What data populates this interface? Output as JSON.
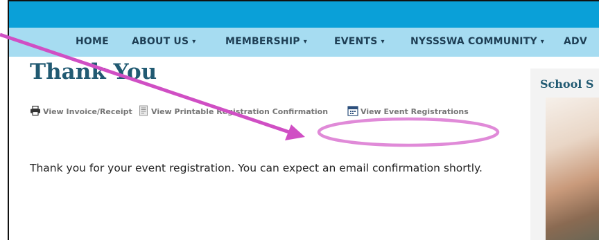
{
  "nav": {
    "items": [
      {
        "label": "HOME",
        "has_caret": false
      },
      {
        "label": "ABOUT US",
        "has_caret": true
      },
      {
        "label": "MEMBERSHIP",
        "has_caret": true
      },
      {
        "label": "EVENTS",
        "has_caret": true
      },
      {
        "label": "NYSSSWA COMMUNITY",
        "has_caret": true
      },
      {
        "label": "ADV",
        "has_caret": false
      }
    ],
    "caret": "▾"
  },
  "page": {
    "title": "Thank You",
    "message": "Thank you for your event registration. You can expect an email confirmation shortly."
  },
  "links": {
    "invoice": {
      "label": "View Invoice/Receipt",
      "icon": "printer-icon"
    },
    "confirmation": {
      "label": "View Printable Registration Confirmation",
      "icon": "document-icon"
    },
    "event_registrations": {
      "label": "View Event Registrations",
      "icon": "calendar-icon"
    }
  },
  "sidebar": {
    "title": "School S"
  },
  "colors": {
    "topbar": "#0aa0d8",
    "navbar": "#a6dcf1",
    "title": "#215a72",
    "annotation": "#d04fc4"
  }
}
